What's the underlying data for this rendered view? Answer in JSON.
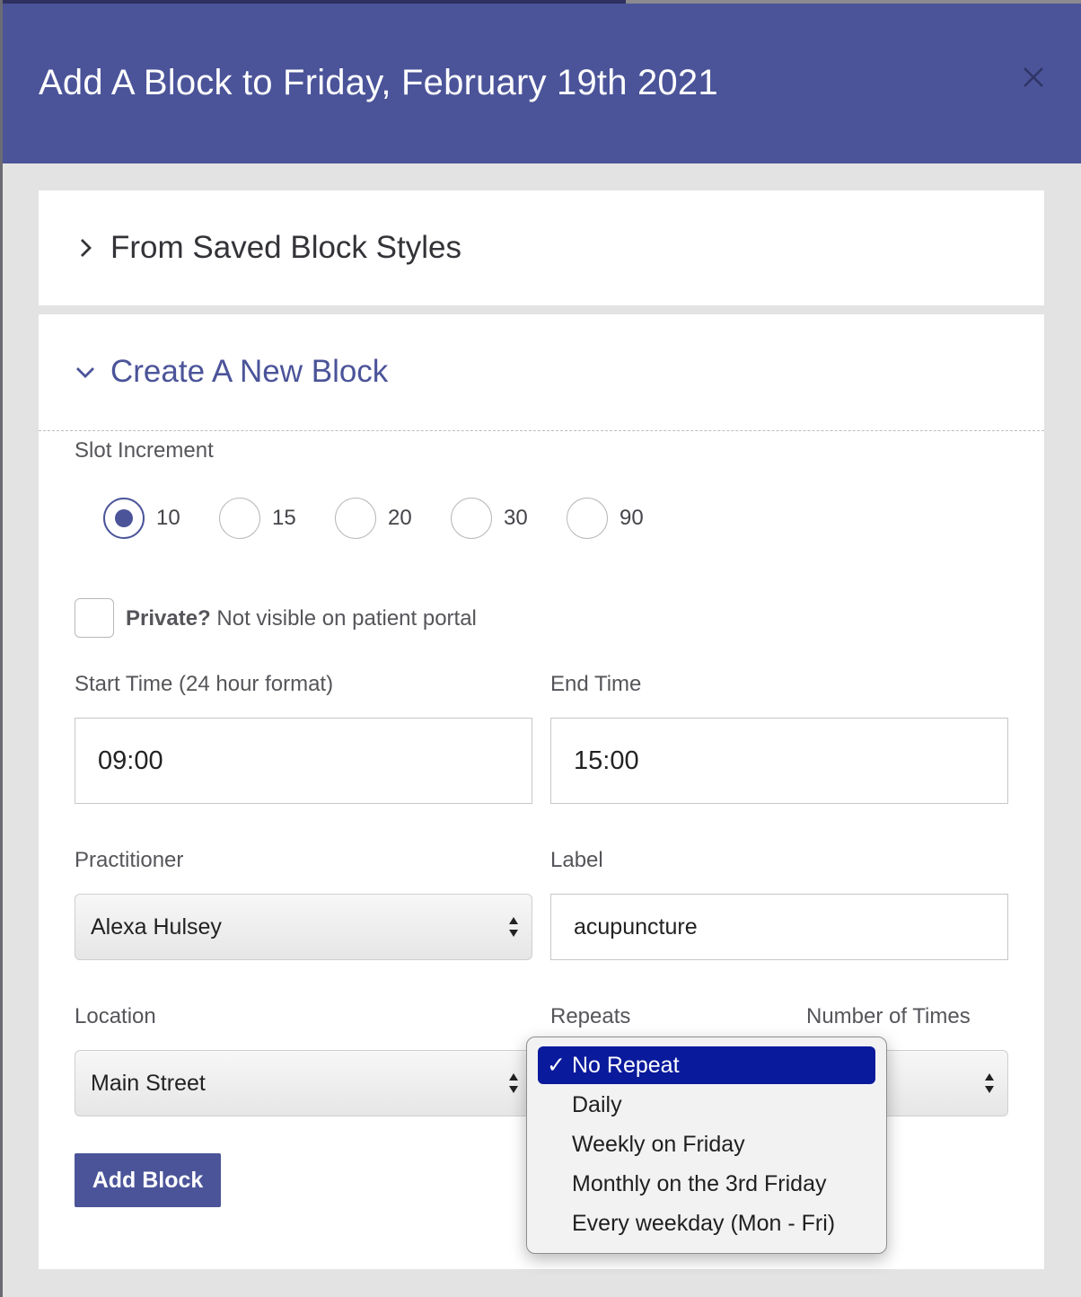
{
  "modal": {
    "title": "Add A Block to Friday, February 19th 2021",
    "close_icon": "close-icon"
  },
  "saved_styles": {
    "label": "From Saved Block Styles",
    "icon": "chevron-right-icon"
  },
  "create_block": {
    "label": "Create A New Block",
    "icon": "chevron-down-icon",
    "slot_increment": {
      "label": "Slot Increment",
      "options": [
        "10",
        "15",
        "20",
        "30",
        "90"
      ],
      "selected": "10"
    },
    "private": {
      "bold": "Private?",
      "text": " Not visible on patient portal",
      "checked": false
    },
    "start_time": {
      "label": "Start Time (24 hour format)",
      "value": "09:00"
    },
    "end_time": {
      "label": "End Time",
      "value": "15:00"
    },
    "practitioner": {
      "label": "Practitioner",
      "value": "Alexa Hulsey"
    },
    "label_field": {
      "label": "Label",
      "value": "acupuncture"
    },
    "location": {
      "label": "Location",
      "value": "Main Street"
    },
    "repeats": {
      "label": "Repeats",
      "options": [
        "No Repeat",
        "Daily",
        "Weekly on Friday",
        "Monthly on the 3rd Friday",
        "Every weekday (Mon - Fri)"
      ],
      "selected": "No Repeat",
      "check_glyph": "✓"
    },
    "number_of_times": {
      "label": "Number of Times"
    },
    "add_button": "Add Block"
  },
  "colors": {
    "header": "#4b5499",
    "accent": "#4b5499",
    "dropdown_selected": "#0a1a9c"
  }
}
